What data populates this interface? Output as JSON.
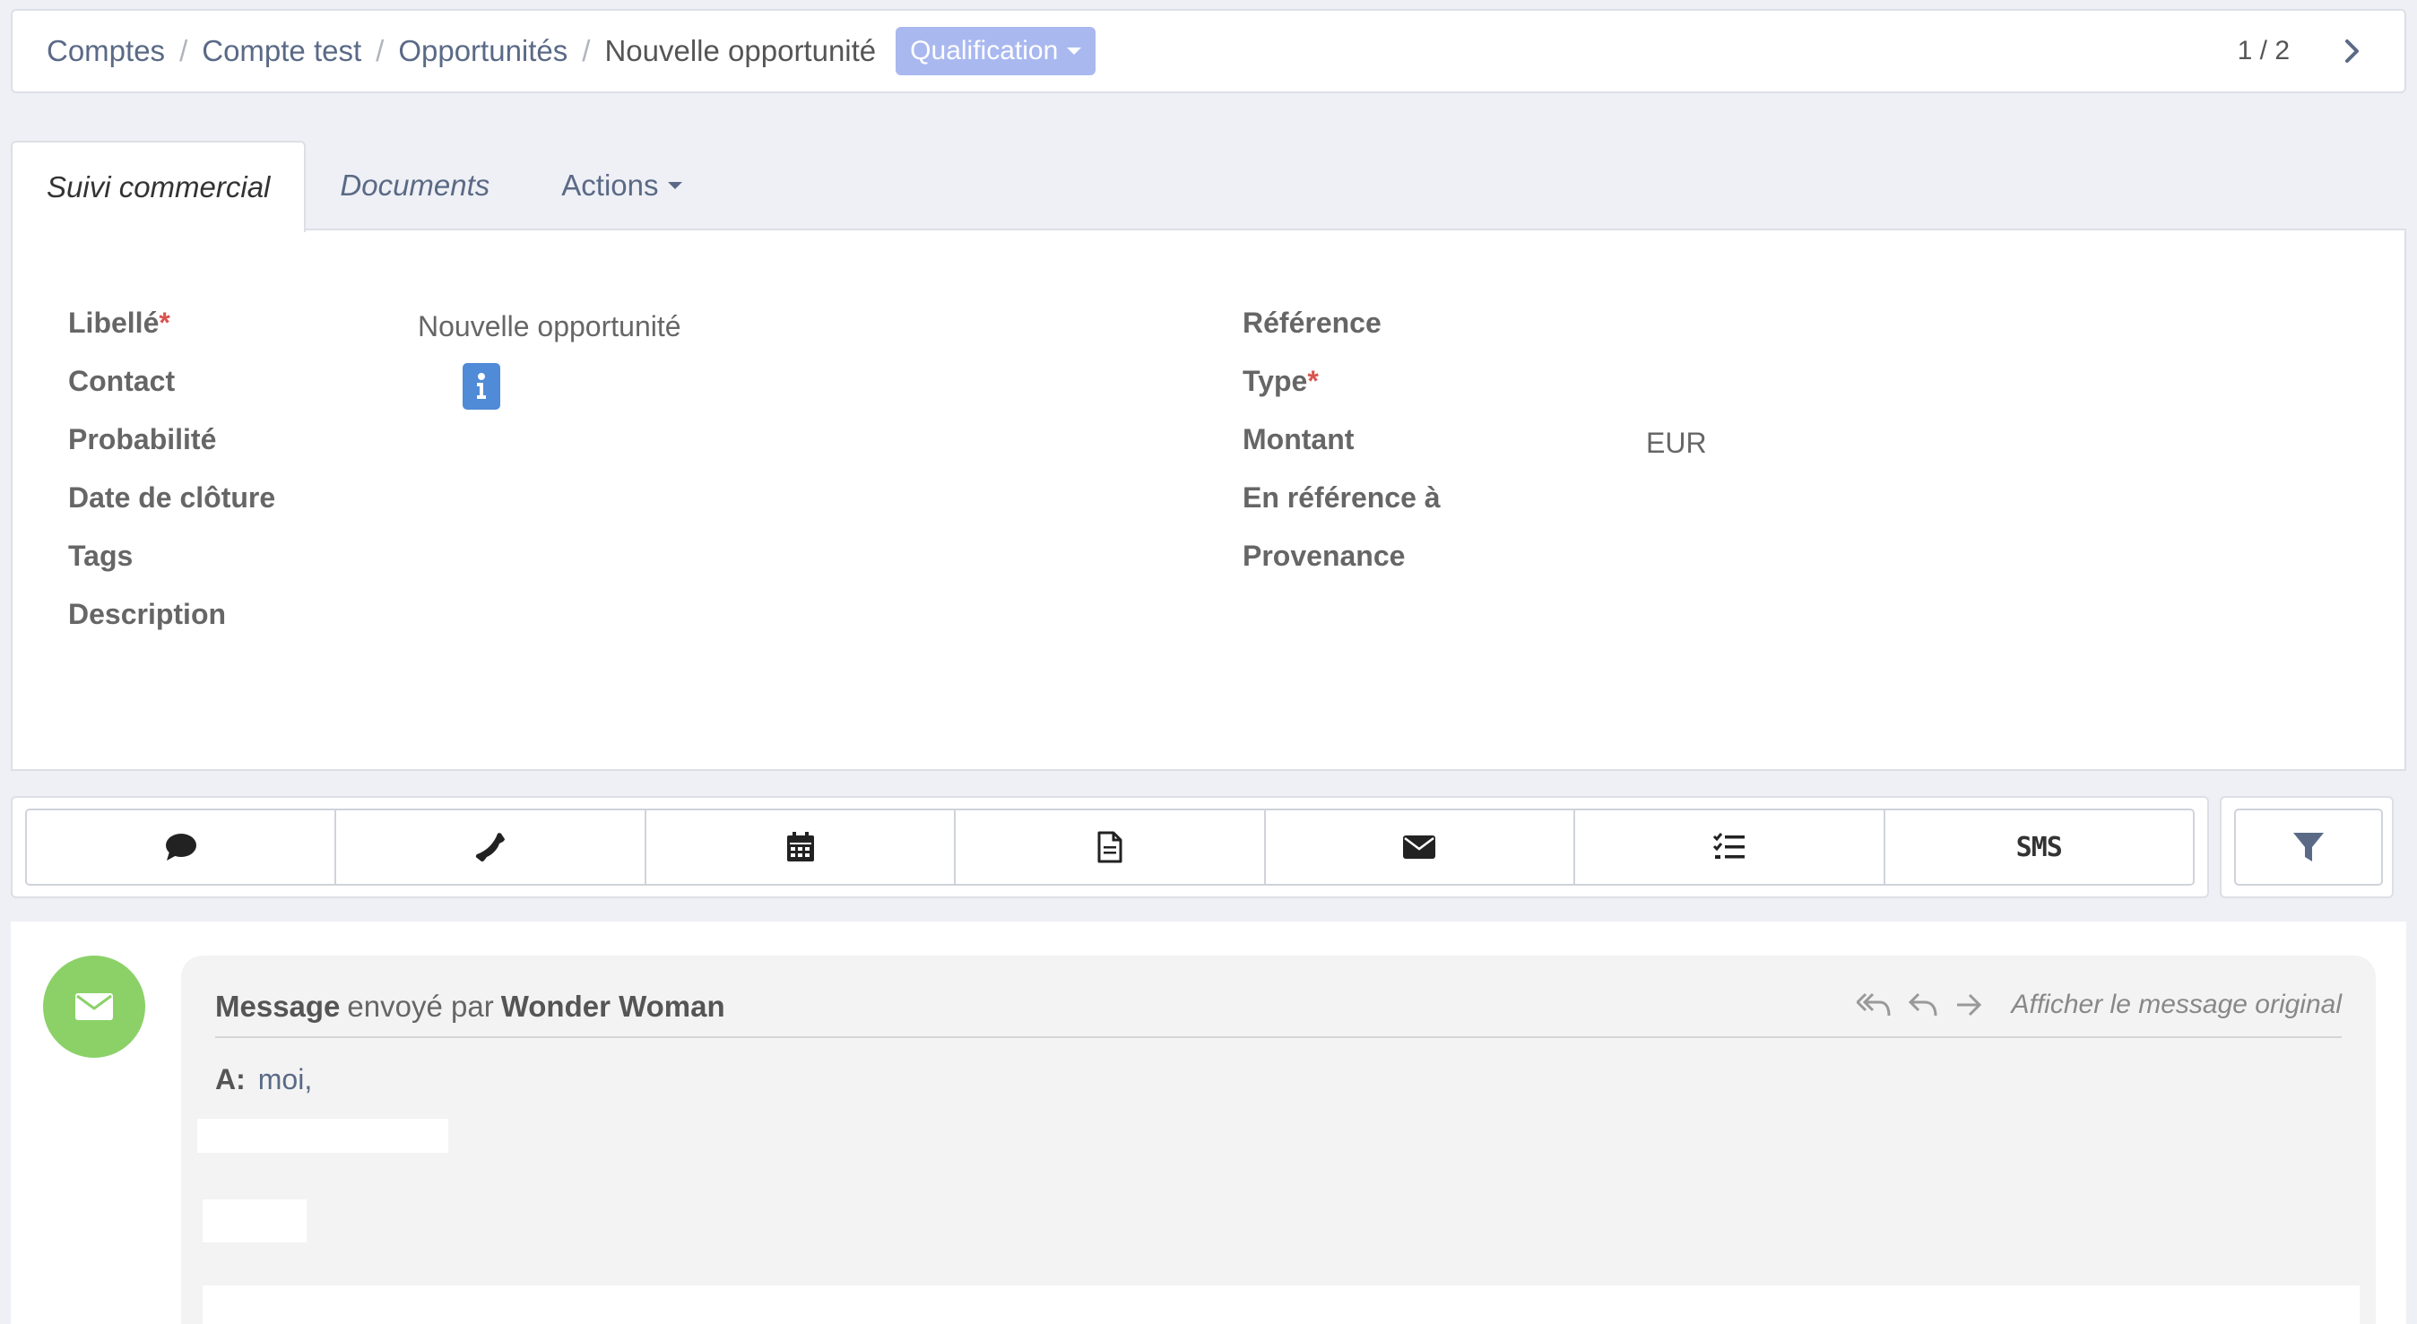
{
  "breadcrumb": {
    "items": [
      "Comptes",
      "Compte test",
      "Opportunités"
    ],
    "separator": "/",
    "current": "Nouvelle opportunité",
    "status_button": "Qualification"
  },
  "pager": {
    "text": "1 / 2"
  },
  "tabs": [
    {
      "label": "Suivi commercial",
      "active": true
    },
    {
      "label": "Documents",
      "active": false
    },
    {
      "label": "Actions",
      "active": false
    }
  ],
  "form": {
    "left": {
      "libelle_label": "Libellé",
      "libelle_value": "Nouvelle opportunité",
      "contact_label": "Contact",
      "probabilite_label": "Probabilité",
      "date_cloture_label": "Date de clôture",
      "tags_label": "Tags",
      "description_label": "Description"
    },
    "right": {
      "reference_label": "Référence",
      "type_label": "Type",
      "montant_label": "Montant",
      "montant_value": "EUR",
      "en_reference_label": "En référence à",
      "provenance_label": "Provenance"
    },
    "required_marker": "*"
  },
  "toolbar": {
    "buttons": [
      "comment-icon",
      "phone-icon",
      "calendar-icon",
      "document-icon",
      "envelope-icon",
      "checklist-icon",
      "SMS"
    ],
    "sms_label": "SMS",
    "filter": "filter-icon"
  },
  "message": {
    "title_bold": "Message",
    "title_plain": "envoyé par",
    "author": "Wonder Woman",
    "original_link": "Afficher le message original",
    "to_label": "A:",
    "to_value": "moi,"
  },
  "colors": {
    "status_button": "#a9b8ef",
    "info_button": "#4f8bd6",
    "avatar": "#8bd168",
    "required": "#d9534f",
    "link": "#5a6a86"
  }
}
